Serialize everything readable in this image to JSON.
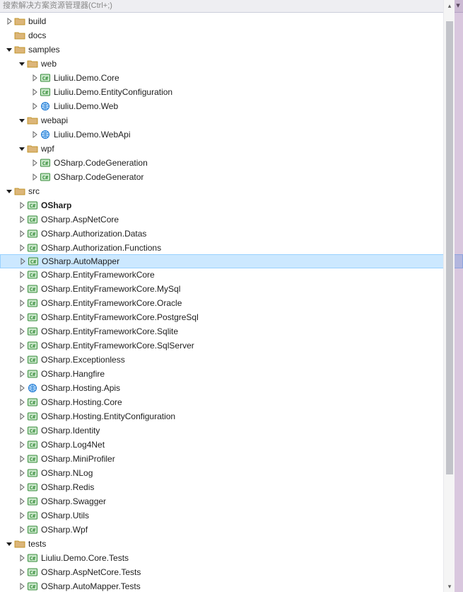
{
  "header": {
    "text": "搜索解决方案资源管理器(Ctrl+;)",
    "chevron": "▾"
  },
  "tree": [
    {
      "depth": 0,
      "expander": "closed",
      "icon": "folder",
      "label": "build"
    },
    {
      "depth": 0,
      "expander": "none",
      "icon": "folder",
      "label": "docs"
    },
    {
      "depth": 0,
      "expander": "open",
      "icon": "folder",
      "label": "samples"
    },
    {
      "depth": 1,
      "expander": "open",
      "icon": "folder",
      "label": "web"
    },
    {
      "depth": 2,
      "expander": "closed",
      "icon": "csproj",
      "label": "Liuliu.Demo.Core"
    },
    {
      "depth": 2,
      "expander": "closed",
      "icon": "csproj",
      "label": "Liuliu.Demo.EntityConfiguration"
    },
    {
      "depth": 2,
      "expander": "closed",
      "icon": "webproj",
      "label": "Liuliu.Demo.Web"
    },
    {
      "depth": 1,
      "expander": "open",
      "icon": "folder",
      "label": "webapi"
    },
    {
      "depth": 2,
      "expander": "closed",
      "icon": "webproj",
      "label": "Liuliu.Demo.WebApi"
    },
    {
      "depth": 1,
      "expander": "open",
      "icon": "folder",
      "label": "wpf"
    },
    {
      "depth": 2,
      "expander": "closed",
      "icon": "csproj",
      "label": "OSharp.CodeGeneration"
    },
    {
      "depth": 2,
      "expander": "closed",
      "icon": "csproj",
      "label": "OSharp.CodeGenerator"
    },
    {
      "depth": 0,
      "expander": "open",
      "icon": "folder",
      "label": "src"
    },
    {
      "depth": 1,
      "expander": "closed",
      "icon": "csproj",
      "label": "OSharp",
      "bold": true
    },
    {
      "depth": 1,
      "expander": "closed",
      "icon": "csproj",
      "label": "OSharp.AspNetCore"
    },
    {
      "depth": 1,
      "expander": "closed",
      "icon": "csproj",
      "label": "OSharp.Authorization.Datas"
    },
    {
      "depth": 1,
      "expander": "closed",
      "icon": "csproj",
      "label": "OSharp.Authorization.Functions"
    },
    {
      "depth": 1,
      "expander": "closed",
      "icon": "csproj",
      "label": "OSharp.AutoMapper",
      "selected": true
    },
    {
      "depth": 1,
      "expander": "closed",
      "icon": "csproj",
      "label": "OSharp.EntityFrameworkCore"
    },
    {
      "depth": 1,
      "expander": "closed",
      "icon": "csproj",
      "label": "OSharp.EntityFrameworkCore.MySql"
    },
    {
      "depth": 1,
      "expander": "closed",
      "icon": "csproj",
      "label": "OSharp.EntityFrameworkCore.Oracle"
    },
    {
      "depth": 1,
      "expander": "closed",
      "icon": "csproj",
      "label": "OSharp.EntityFrameworkCore.PostgreSql"
    },
    {
      "depth": 1,
      "expander": "closed",
      "icon": "csproj",
      "label": "OSharp.EntityFrameworkCore.Sqlite"
    },
    {
      "depth": 1,
      "expander": "closed",
      "icon": "csproj",
      "label": "OSharp.EntityFrameworkCore.SqlServer"
    },
    {
      "depth": 1,
      "expander": "closed",
      "icon": "csproj",
      "label": "OSharp.Exceptionless"
    },
    {
      "depth": 1,
      "expander": "closed",
      "icon": "csproj",
      "label": "OSharp.Hangfire"
    },
    {
      "depth": 1,
      "expander": "closed",
      "icon": "webproj",
      "label": "OSharp.Hosting.Apis"
    },
    {
      "depth": 1,
      "expander": "closed",
      "icon": "csproj",
      "label": "OSharp.Hosting.Core"
    },
    {
      "depth": 1,
      "expander": "closed",
      "icon": "csproj",
      "label": "OSharp.Hosting.EntityConfiguration"
    },
    {
      "depth": 1,
      "expander": "closed",
      "icon": "csproj",
      "label": "OSharp.Identity"
    },
    {
      "depth": 1,
      "expander": "closed",
      "icon": "csproj",
      "label": "OSharp.Log4Net"
    },
    {
      "depth": 1,
      "expander": "closed",
      "icon": "csproj",
      "label": "OSharp.MiniProfiler"
    },
    {
      "depth": 1,
      "expander": "closed",
      "icon": "csproj",
      "label": "OSharp.NLog"
    },
    {
      "depth": 1,
      "expander": "closed",
      "icon": "csproj",
      "label": "OSharp.Redis"
    },
    {
      "depth": 1,
      "expander": "closed",
      "icon": "csproj",
      "label": "OSharp.Swagger"
    },
    {
      "depth": 1,
      "expander": "closed",
      "icon": "csproj",
      "label": "OSharp.Utils"
    },
    {
      "depth": 1,
      "expander": "closed",
      "icon": "csproj",
      "label": "OSharp.Wpf"
    },
    {
      "depth": 0,
      "expander": "open",
      "icon": "folder",
      "label": "tests"
    },
    {
      "depth": 1,
      "expander": "closed",
      "icon": "csproj",
      "label": "Liuliu.Demo.Core.Tests"
    },
    {
      "depth": 1,
      "expander": "closed",
      "icon": "csproj",
      "label": "OSharp.AspNetCore.Tests"
    },
    {
      "depth": 1,
      "expander": "closed",
      "icon": "csproj",
      "label": "OSharp.AutoMapper.Tests"
    }
  ],
  "colors": {
    "selection_bg": "#cce8ff",
    "selection_border": "#99d1ff",
    "folder_fill": "#dcb67a",
    "folder_stroke": "#b8860b",
    "csproj_fill": "#c8e6c9",
    "csproj_stroke": "#388e3c",
    "csproj_text": "#388e3c",
    "web_fill": "#bbdefb",
    "web_stroke": "#1976d2"
  }
}
